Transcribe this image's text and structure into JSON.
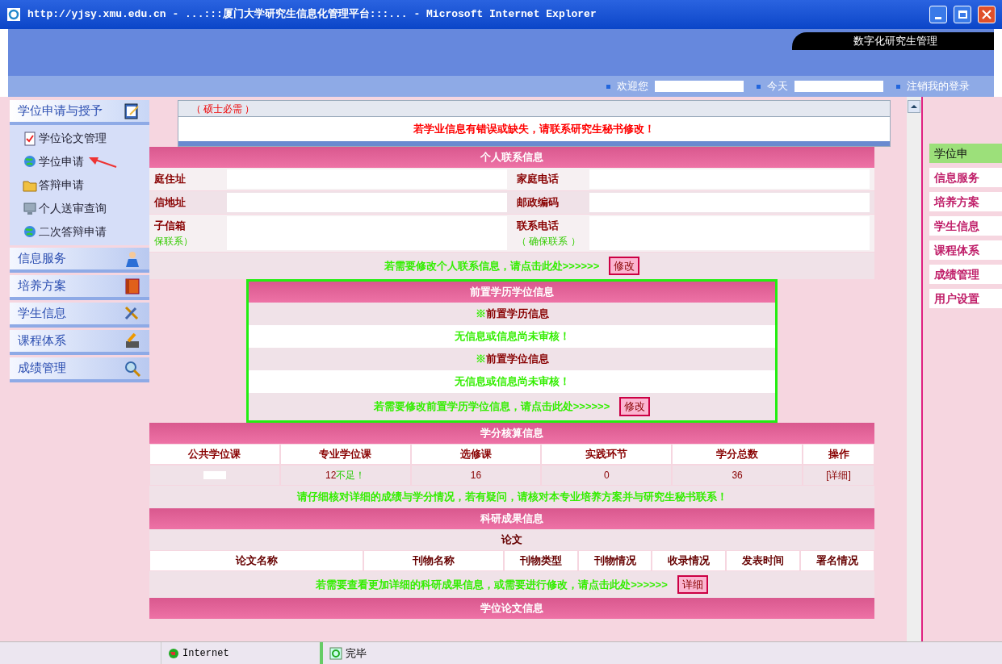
{
  "window": {
    "title": "http://yjsy.xmu.edu.cn - ...:::厦门大学研究生信息化管理平台:::... - Microsoft Internet Explorer"
  },
  "header": {
    "banner": "数字化研究生管理",
    "welcome": "欢迎您",
    "today": "今天",
    "logout": "注销我的登录"
  },
  "sidebar": {
    "groups": [
      {
        "label": "学位申请与授予",
        "expanded": true,
        "items": [
          {
            "label": "学位论文管理",
            "arrow": false
          },
          {
            "label": "学位申请",
            "arrow": true
          },
          {
            "label": "答辩申请",
            "arrow": false
          },
          {
            "label": "个人送审查询",
            "arrow": false
          },
          {
            "label": "二次答辩申请",
            "arrow": false
          }
        ]
      },
      {
        "label": "信息服务",
        "expanded": false
      },
      {
        "label": "培养方案",
        "expanded": false
      },
      {
        "label": "学生信息",
        "expanded": false
      },
      {
        "label": "课程体系",
        "expanded": false
      },
      {
        "label": "成绩管理",
        "expanded": false
      }
    ]
  },
  "top_box": {
    "cell": "（ 硕士必需 ）",
    "message": "若学业信息有错误或缺失，请联系研究生秘书修改！"
  },
  "contact": {
    "title": "个人联系信息",
    "rows": [
      [
        {
          "label": "庭住址"
        },
        {
          "label": "家庭电话"
        }
      ],
      [
        {
          "label": "信地址"
        },
        {
          "label": "邮政编码"
        }
      ],
      [
        {
          "label": "子信箱",
          "note": "保联系）"
        },
        {
          "label": "联系电话",
          "note": "（ 确保联系 ）"
        }
      ]
    ],
    "edit": {
      "text": "若需要修改个人联系信息，请点击此处>>>>>>",
      "button": "修改"
    }
  },
  "prior": {
    "title": "前置学历学位信息",
    "entries": [
      {
        "kind": "heading",
        "mark": "※",
        "text": "前置学历信息"
      },
      {
        "kind": "status",
        "text": "无信息或信息尚未审核！"
      },
      {
        "kind": "heading",
        "mark": "※",
        "text": "前置学位信息"
      },
      {
        "kind": "status",
        "text": "无信息或信息尚未审核！"
      }
    ],
    "edit": {
      "text": "若需要修改前置学历学位信息，请点击此处>>>>>>",
      "button": "修改"
    }
  },
  "credits": {
    "title": "学分核算信息",
    "columns": [
      "公共学位课",
      "专业学位课",
      "选修课",
      "实践环节",
      "学分总数",
      "操作"
    ],
    "row": [
      {
        "kind": "redacted"
      },
      {
        "kind": "text",
        "value": "12",
        "note": "不足！"
      },
      {
        "kind": "text",
        "value": "16"
      },
      {
        "kind": "text",
        "value": "0"
      },
      {
        "kind": "text",
        "value": "36"
      },
      {
        "kind": "link",
        "value": "[详细]"
      }
    ],
    "note": "请仔细核对详细的成绩与学分情况，若有疑问，请核对本专业培养方案并与研究生秘书联系！"
  },
  "research": {
    "title": "科研成果信息",
    "subtitle": "论文",
    "columns": [
      "论文名称",
      "刊物名称",
      "刊物类型",
      "刊物情况",
      "收录情况",
      "发表时间",
      "署名情况"
    ],
    "edit": {
      "text": "若需要查看更加详细的科研成果信息，或需要进行修改，请点击此处>>>>>>",
      "button": "详细"
    }
  },
  "thesis": {
    "title": "学位论文信息"
  },
  "right_nav": {
    "items": [
      {
        "label": "学位申",
        "selected": true
      },
      {
        "label": "信息服务",
        "selected": false
      },
      {
        "label": "培养方案",
        "selected": false
      },
      {
        "label": "学生信息",
        "selected": false
      },
      {
        "label": "课程体系",
        "selected": false
      },
      {
        "label": "成绩管理",
        "selected": false
      },
      {
        "label": "用户设置",
        "selected": false
      }
    ]
  },
  "status_bar": {
    "zone": "Internet",
    "status": "完毕"
  }
}
